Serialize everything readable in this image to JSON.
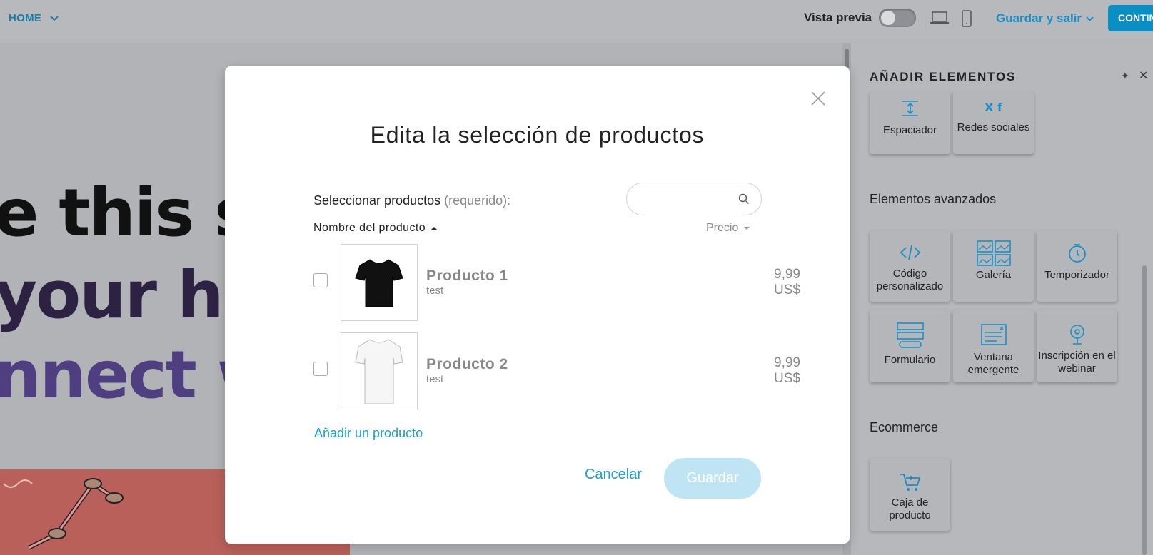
{
  "topbar": {
    "home_label": "HOME",
    "preview_label": "Vista previa",
    "save_exit_label": "Guardar y salir",
    "continue_label": "CONTINUAR"
  },
  "canvas": {
    "hero_line1": "e this sp",
    "hero_line2": "your he",
    "hero_line3": "nnect w"
  },
  "panel": {
    "title": "AÑADIR ELEMENTOS",
    "basic_tiles": [
      {
        "label": "Espaciador",
        "icon": "spacer-icon"
      },
      {
        "label": "Redes sociales",
        "icon": "social-icon"
      }
    ],
    "advanced_section": "Elementos avanzados",
    "advanced_tiles": [
      {
        "label": "Código personalizado",
        "icon": "code-icon"
      },
      {
        "label": "Galería",
        "icon": "gallery-icon"
      },
      {
        "label": "Temporizador",
        "icon": "timer-icon"
      },
      {
        "label": "Formulario",
        "icon": "form-icon"
      },
      {
        "label": "Ventana emergente",
        "icon": "popup-icon"
      },
      {
        "label": "Inscripción en el webinar",
        "icon": "webinar-icon"
      }
    ],
    "ecommerce_section": "Ecommerce",
    "ecommerce_tiles": [
      {
        "label": "Caja de producto",
        "icon": "cart-icon"
      }
    ]
  },
  "modal": {
    "title": "Edita la selección de productos",
    "select_label": "Seleccionar productos",
    "select_required": "(requerido):",
    "search_placeholder": "",
    "col_name": "Nombre del producto",
    "col_price": "Precio",
    "products": [
      {
        "name": "Producto 1",
        "desc": "test",
        "price": "9,99 US$",
        "color": "#111111"
      },
      {
        "name": "Producto 2",
        "desc": "test",
        "price": "9,99 US$",
        "color": "#f4f4f4"
      }
    ],
    "add_product": "Añadir un producto",
    "cancel": "Cancelar",
    "save": "Guardar"
  }
}
